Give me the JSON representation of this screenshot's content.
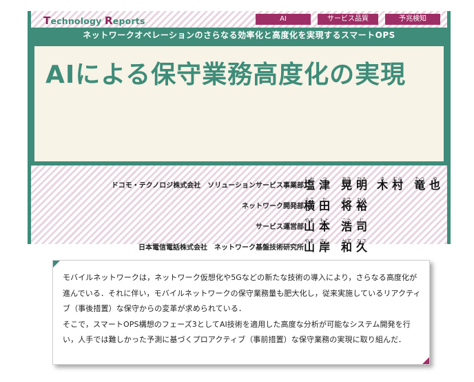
{
  "header": {
    "brand_cap1": "T",
    "brand_rest1": "echnology ",
    "brand_cap2": "R",
    "brand_rest2": "eports",
    "tags": [
      "AI",
      "サービス品質監視",
      "予兆検知"
    ],
    "subtitle": "ネットワークオペレーションのさらなる効率化と高度化を実現するスマートOPS",
    "title": "AIによる保守業務高度化の実現"
  },
  "authors": [
    {
      "affiliation": "ドコモ・テクノロジ株式会社　ソリューションサービス事業部",
      "people": [
        [
          [
            "塩",
            "しお"
          ],
          [
            "津",
            "つ"
          ],
          [
            "晃",
            "あき"
          ],
          [
            "明",
            "ひろ"
          ]
        ],
        [
          [
            "木",
            "き"
          ],
          [
            "村",
            "むら"
          ],
          [
            "竜",
            "たつ"
          ],
          [
            "也",
            "や"
          ]
        ]
      ]
    },
    {
      "affiliation": "ネットワーク開発部",
      "people": [
        [
          [
            "横",
            "よこ"
          ],
          [
            "田",
            "た"
          ],
          [
            "将",
            "まさ"
          ],
          [
            "裕",
            "ひろ"
          ]
        ]
      ]
    },
    {
      "affiliation": "サービス運営部",
      "people": [
        [
          [
            "山",
            "やま"
          ],
          [
            "本",
            "もと"
          ],
          [
            "浩",
            "こう"
          ],
          [
            "司",
            "じ"
          ]
        ]
      ]
    },
    {
      "affiliation": "日本電信電話株式会社　ネットワーク基盤技術研究所",
      "people": [
        [
          [
            "山",
            "やま"
          ],
          [
            "岸",
            "ぎし"
          ],
          [
            "和",
            "かず"
          ],
          [
            "久",
            "ひさ"
          ]
        ]
      ]
    }
  ],
  "summary": {
    "p1": "モバイルネットワークは，ネットワーク仮想化や5Gなどの新たな技術の導入により，さらなる高度化が進んでいる．それに伴い，モバイルネットワークの保守業務量も肥大化し，従来実施しているリアクティブ（事後措置）な保守からの変革が求められている．",
    "p2": "そこで，スマートOPS構想のフェーズ3としてAI技術を適用した高度な分析が可能なシステム開発を行い，人手では難しかった予測に基づくプロアクティブ（事前措置）な保守業務の実現に取り組んだ．"
  },
  "colors": {
    "green": "#3e8c79",
    "magenta": "#9e2e66",
    "cream": "#f7f3e6"
  }
}
